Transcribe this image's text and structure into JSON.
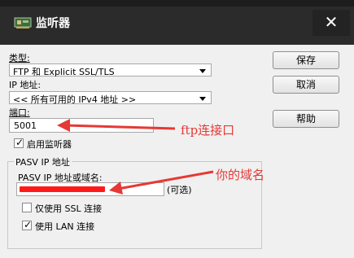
{
  "window": {
    "title": "监听器",
    "close_glyph": "✕"
  },
  "form": {
    "type_label": "类型:",
    "type_value": "FTP 和 Explicit SSL/TLS",
    "ip_label": "IP 地址:",
    "ip_value": "<< 所有可用的 IPv4 地址 >>",
    "port_label": "端口:",
    "port_value": "5001",
    "enable_listener_label": "启用监听器",
    "enable_listener_checked": true
  },
  "pasv": {
    "group_title": "PASV IP 地址",
    "domain_label": "PASV IP 地址或域名:",
    "domain_value": "",
    "optional_label": "(可选)",
    "ssl_only_label": "仅使用 SSL 连接",
    "ssl_only_checked": false,
    "lan_label": "使用 LAN 连接",
    "lan_checked": true
  },
  "buttons": {
    "save": "保存",
    "cancel": "取消",
    "help": "帮助"
  },
  "annotations": {
    "port_note": "ftp连接口",
    "domain_note": "你的域名"
  },
  "colors": {
    "titlebar": "#2b2b2b",
    "annotation": "#e53935",
    "redaction": "#ff1a1a"
  }
}
